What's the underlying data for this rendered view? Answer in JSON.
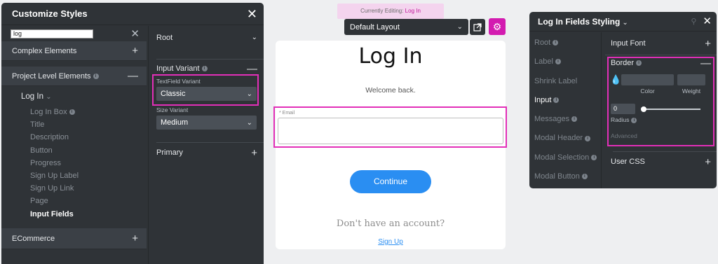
{
  "customize_panel": {
    "title": "Customize Styles",
    "search_value": "log",
    "groups": {
      "complex": "Complex Elements",
      "project": "Project Level Elements",
      "ecommerce": "ECommerce"
    },
    "tree_root": "Log In",
    "tree_children": [
      "Log In Box",
      "Title",
      "Description",
      "Button",
      "Progress",
      "Sign Up Label",
      "Sign Up Link",
      "Page",
      "Input Fields"
    ],
    "sections": {
      "root": "Root",
      "input_variant": "Input Variant",
      "textfield_variant_label": "TextField Variant",
      "textfield_variant_value": "Classic",
      "size_variant_label": "Size Variant",
      "size_variant_value": "Medium",
      "primary": "Primary"
    }
  },
  "canvas": {
    "banner_prefix": "Currently Editing: ",
    "banner_target": "Log In",
    "layout": "Default Layout",
    "title": "Log In",
    "welcome": "Welcome back.",
    "email_label": "* Email",
    "continue": "Continue",
    "no_account": "Don't have an account?",
    "signup": "Sign Up"
  },
  "fields_panel": {
    "title": "Log In Fields Styling",
    "nav": [
      "Root",
      "Label",
      "Shrink Label",
      "Input",
      "Messages",
      "Modal Header",
      "Modal Selection",
      "Modal Button"
    ],
    "input_font": "Input Font",
    "border": "Border",
    "color_label": "Color",
    "weight_label": "Weight",
    "radius_value": "0",
    "radius_label": "Radius",
    "advanced": "Advanced",
    "user_css": "User CSS"
  },
  "colors": {
    "panel_bg": "#2f3337",
    "highlight": "#e22fb8",
    "accent": "#2a8ef2",
    "gear_bg": "#d31bb0"
  },
  "icons": [
    "close-icon",
    "clear-icon",
    "plus-icon",
    "minus-icon",
    "info-icon",
    "chevron-down-icon",
    "external-link-icon",
    "gear-icon",
    "pin-icon",
    "drop-icon"
  ]
}
